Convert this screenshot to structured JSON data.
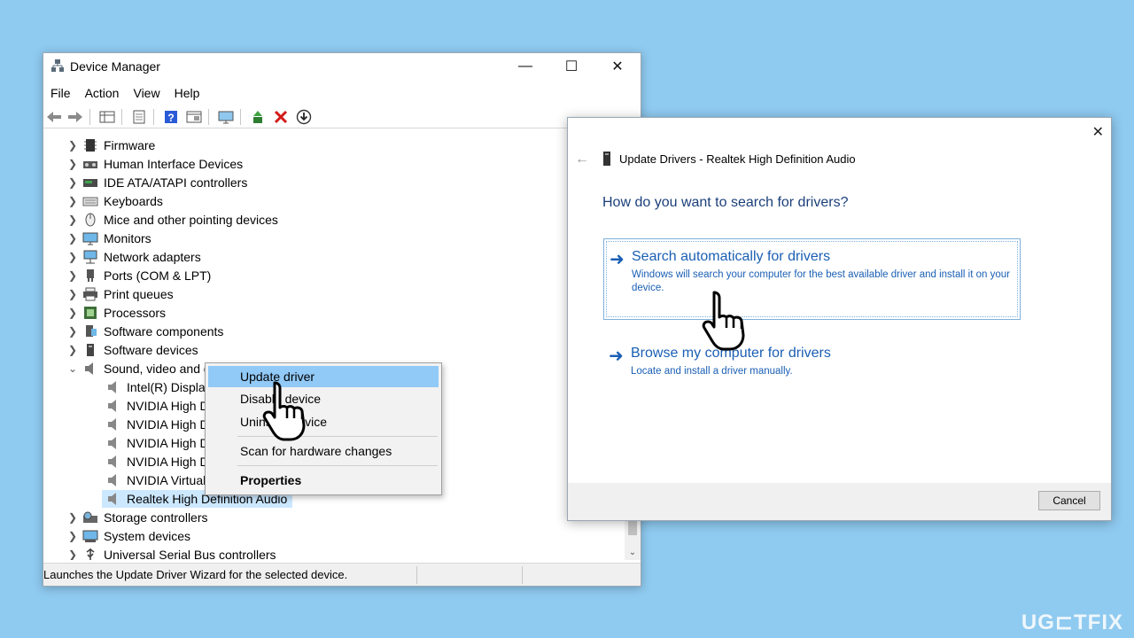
{
  "device_manager": {
    "title": "Device Manager",
    "menu": [
      "File",
      "Action",
      "View",
      "Help"
    ],
    "tree": [
      {
        "label": "Firmware",
        "icon": "firmware-icon"
      },
      {
        "label": "Human Interface Devices",
        "icon": "hid-icon"
      },
      {
        "label": "IDE ATA/ATAPI controllers",
        "icon": "ide-icon"
      },
      {
        "label": "Keyboards",
        "icon": "keyboard-icon"
      },
      {
        "label": "Mice and other pointing devices",
        "icon": "mouse-icon"
      },
      {
        "label": "Monitors",
        "icon": "monitor-icon"
      },
      {
        "label": "Network adapters",
        "icon": "network-icon"
      },
      {
        "label": "Ports (COM & LPT)",
        "icon": "port-icon"
      },
      {
        "label": "Print queues",
        "icon": "printer-icon"
      },
      {
        "label": "Processors",
        "icon": "processor-icon"
      },
      {
        "label": "Software components",
        "icon": "software-component-icon"
      },
      {
        "label": "Software devices",
        "icon": "software-device-icon"
      },
      {
        "label": "Sound, video and game controllers",
        "icon": "speaker-icon"
      }
    ],
    "sound_children": [
      "Intel(R) Display Audio",
      "NVIDIA High Definition Audio",
      "NVIDIA High Definition Audio",
      "NVIDIA High Definition Audio",
      "NVIDIA High Definition Audio",
      "NVIDIA Virtual Audio Device",
      "Realtek High Definition Audio"
    ],
    "tree_after": [
      {
        "label": "Storage controllers",
        "icon": "storage-icon"
      },
      {
        "label": "System devices",
        "icon": "system-icon"
      },
      {
        "label": "Universal Serial Bus controllers",
        "icon": "usb-icon"
      }
    ],
    "status": "Launches the Update Driver Wizard for the selected device."
  },
  "context_menu": {
    "items": [
      "Update driver",
      "Disable device",
      "Uninstall device",
      "Scan for hardware changes",
      "Properties"
    ]
  },
  "update_dialog": {
    "title": "Update Drivers - Realtek High Definition Audio",
    "heading": "How do you want to search for drivers?",
    "option1": {
      "title": "Search automatically for drivers",
      "desc": "Windows will search your computer for the best available driver and install it on your device."
    },
    "option2": {
      "title": "Browse my computer for drivers",
      "desc": "Locate and install a driver manually."
    },
    "cancel": "Cancel"
  },
  "watermark": "UG⊏TFIX",
  "colors": {
    "background": "#8fcaf0",
    "accent": "#1a5fb4",
    "highlight": "#91c9f7"
  }
}
